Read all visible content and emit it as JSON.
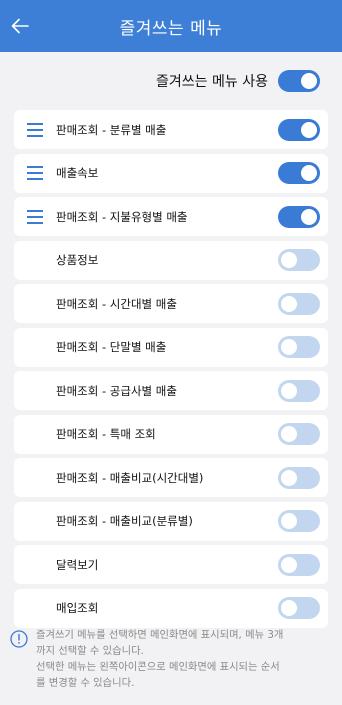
{
  "header": {
    "title": "즐겨쓰는 메뉴",
    "back_icon": "arrow-left-icon"
  },
  "master_toggle": {
    "label": "즐겨쓰는 메뉴 사용",
    "on": true
  },
  "menu_items": [
    {
      "label": "판매조회 - 분류별 매출",
      "on": true,
      "draggable": true
    },
    {
      "label": "매출속보",
      "on": true,
      "draggable": true
    },
    {
      "label": "판매조회 - 지불유형별 매출",
      "on": true,
      "draggable": true
    },
    {
      "label": "상품정보",
      "on": false,
      "draggable": false
    },
    {
      "label": "판매조회 - 시간대별 매출",
      "on": false,
      "draggable": false
    },
    {
      "label": "판매조회 - 단말별 매출",
      "on": false,
      "draggable": false
    },
    {
      "label": "판매조회 - 공급사별 매출",
      "on": false,
      "draggable": false
    },
    {
      "label": "판매조회 - 특매 조회",
      "on": false,
      "draggable": false
    },
    {
      "label": "판매조회 - 매출비교(시간대별)",
      "on": false,
      "draggable": false
    },
    {
      "label": "판매조회 - 매출비교(분류별)",
      "on": false,
      "draggable": false
    },
    {
      "label": "달력보기",
      "on": false,
      "draggable": false
    },
    {
      "label": "매입조회",
      "on": false,
      "draggable": false
    }
  ],
  "notice": {
    "icon": "info-icon",
    "line1": "즐겨쓰기 메뉴를 선택하면 메인화면에 표시되며, 메뉴 3개",
    "line2": "까지 선택할 수 있습니다.",
    "line3": "선택한 메뉴는 왼쪽아이콘으로 메인화면에 표시되는 순서",
    "line4": "를 변경할 수 있습니다."
  },
  "colors": {
    "header_bg": "#3d7fd6",
    "toggle_on": "#3a7bd5",
    "toggle_off": "#c3d6ef",
    "drag_icon": "#3a7bd5",
    "page_bg": "#f2f2f4"
  }
}
